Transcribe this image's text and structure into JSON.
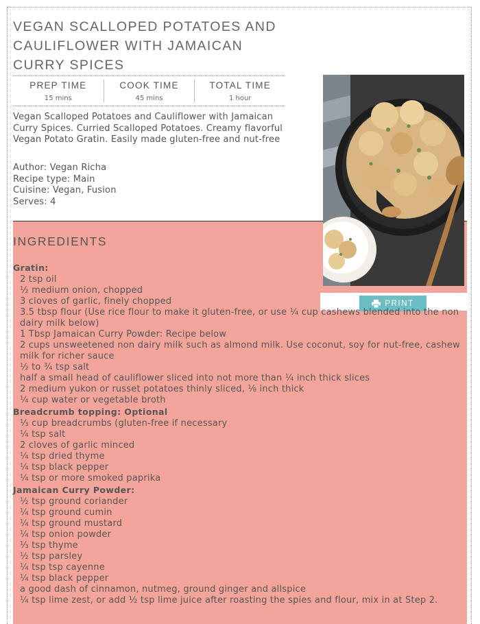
{
  "recipe": {
    "title": "VEGAN SCALLOPED POTATOES AND CAULIFLOWER WITH JAMAICAN CURRY SPICES",
    "times": [
      {
        "label": "PREP TIME",
        "value": "15 mins"
      },
      {
        "label": "COOK TIME",
        "value": "45 mins"
      },
      {
        "label": "TOTAL TIME",
        "value": "1 hour"
      }
    ],
    "summary": "Vegan Scalloped Potatoes and Cauliflower with Jamaican Curry Spices. Curried Scalloped Potatoes. Creamy flavorful Vegan Potato Gratin. Easily made gluten-free and nut-free",
    "meta": [
      "Author: Vegan Richa",
      "Recipe type: Main",
      "Cuisine: Vegan, Fusion",
      "Serves: 4"
    ],
    "print_label": "PRINT",
    "print_icon": "printer-icon",
    "ingredients_heading": "INGREDIENTS",
    "accent_color": "#f4a59b",
    "button_color": "#6cbdc4",
    "groups": [
      {
        "title": "Gratin:",
        "items": [
          "2 tsp oil",
          "½ medium onion, chopped",
          "3 cloves of garlic, finely chopped",
          "3.5 tbsp flour (Use rice flour to make it gluten-free, or use ¼ cup cashews blended into the non dairy milk below)",
          "1 Tbsp Jamaican Curry Powder: Recipe below",
          "2 cups unsweetened non dairy milk such as almond milk. Use coconut, soy for nut-free, cashew milk for richer sauce",
          "½ to ¾ tsp salt",
          "half a small head of cauliflower sliced into not more than ¼ inch thick slices",
          "2 medium yukon or russet potatoes thinly sliced, ⅛ inch thick",
          "¼ cup water or vegetable broth"
        ]
      },
      {
        "title": "Breadcrumb topping: Optional",
        "items": [
          "⅓ cup breadcrumbs (gluten-free if necessary",
          "¼ tsp salt",
          "2 cloves of garlic minced",
          "¼ tsp dried thyme",
          "¼ tsp black pepper",
          "¼ tsp or more smoked paprika"
        ]
      },
      {
        "title": "Jamaican Curry Powder:",
        "items": [
          "½ tsp ground coriander",
          "¼ tsp ground cumin",
          "¼ tsp ground mustard",
          "¼ tsp onion powder",
          "⅓ tsp thyme",
          "½ tsp parsley",
          "¼ tsp tsp cayenne",
          "¼ tsp black pepper",
          "a good dash of cinnamon, nutmeg, ground ginger and allspice",
          "¼ tsp lime zest, or add ½ tsp lime juice after roasting the spies and flour, mix in at Step 2."
        ]
      }
    ]
  }
}
